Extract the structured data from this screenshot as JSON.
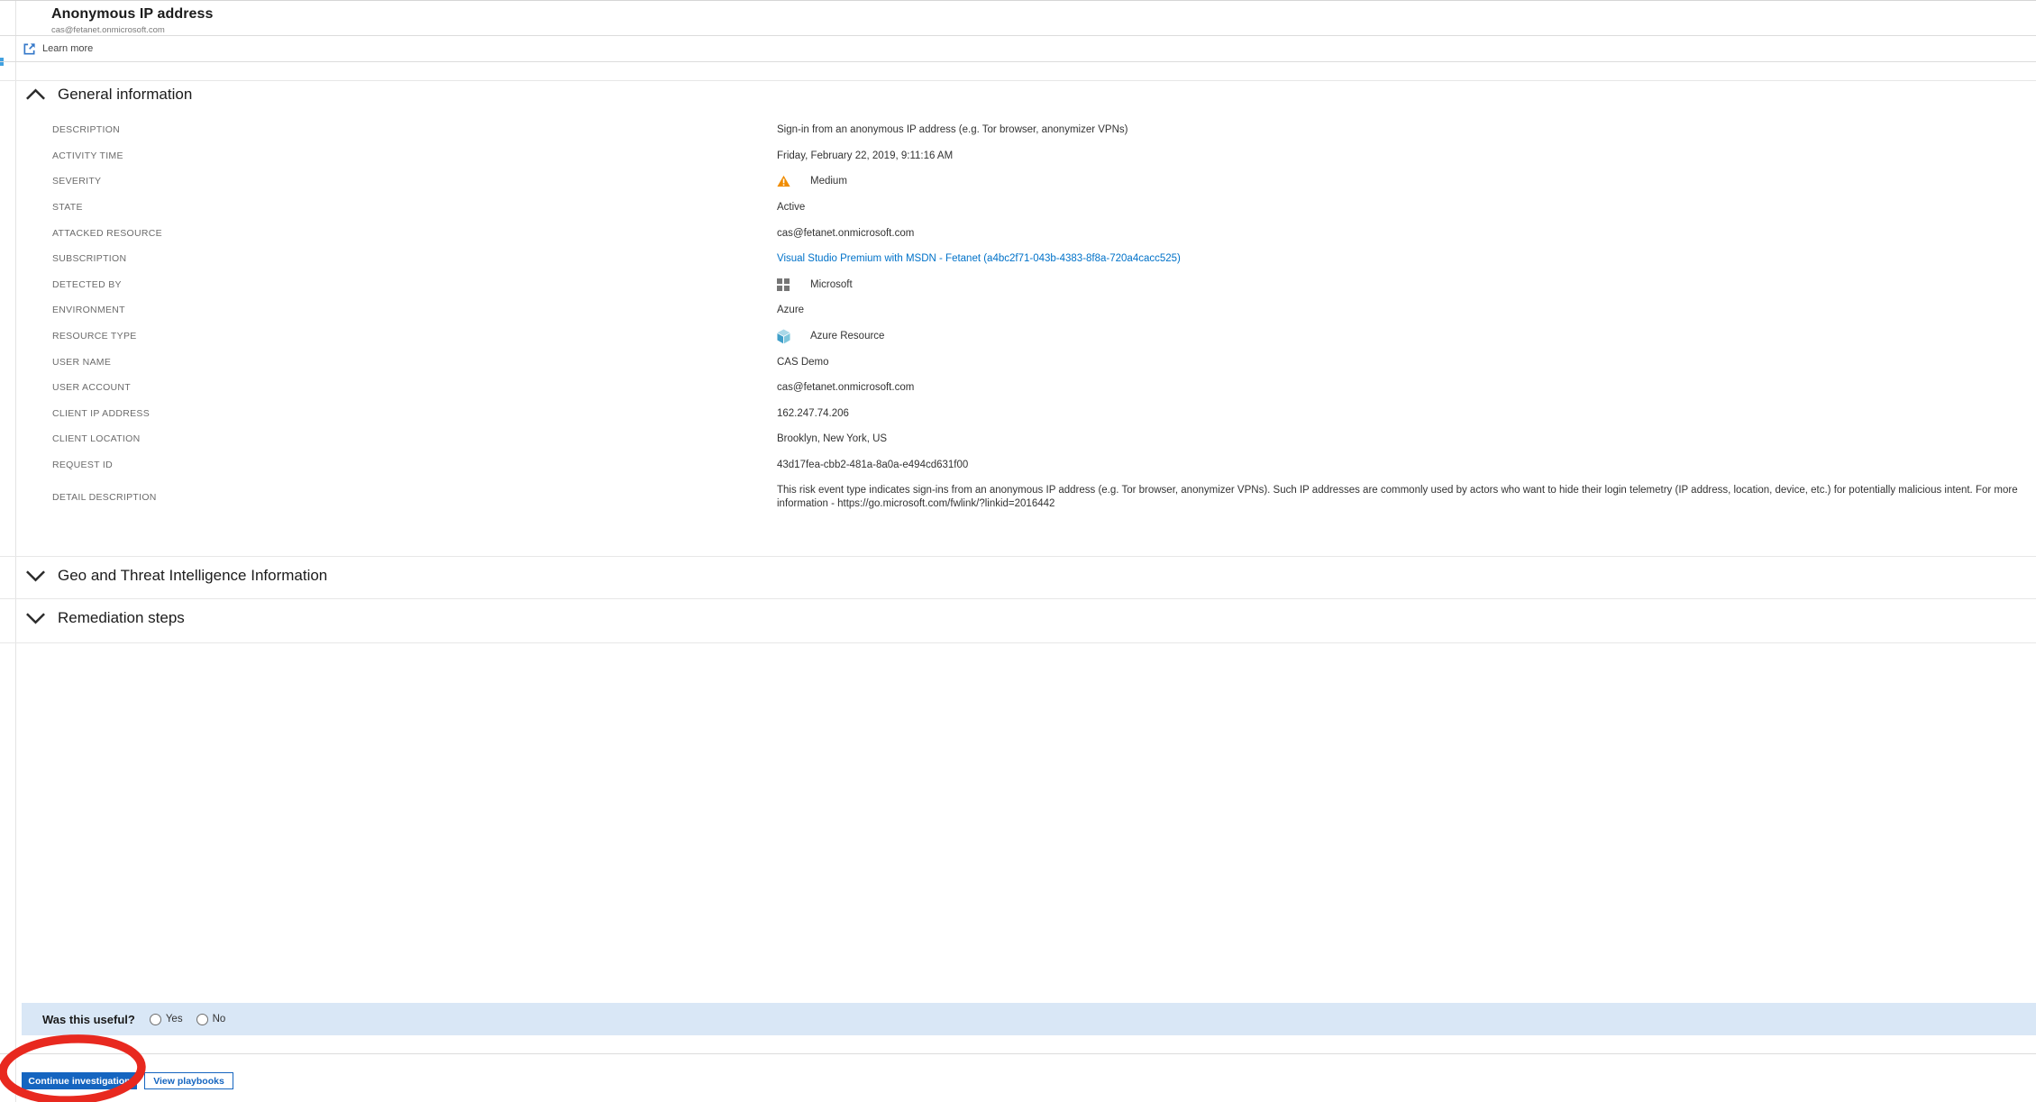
{
  "header": {
    "title": "Anonymous IP address",
    "subtitle": "cas@fetanet.onmicrosoft.com",
    "learn_more_label": "Learn more"
  },
  "sections": {
    "general": {
      "title": "General information",
      "expanded": true
    },
    "geo": {
      "title": "Geo and Threat Intelligence Information",
      "expanded": false
    },
    "remediation": {
      "title": "Remediation steps",
      "expanded": false
    }
  },
  "general": {
    "fields": {
      "description": {
        "label": "DESCRIPTION",
        "value": "Sign-in from an anonymous IP address (e.g. Tor browser, anonymizer VPNs)"
      },
      "activity_time": {
        "label": "ACTIVITY TIME",
        "value": "Friday, February 22, 2019, 9:11:16 AM"
      },
      "severity": {
        "label": "SEVERITY",
        "value": "Medium",
        "icon": "warning-icon"
      },
      "state": {
        "label": "STATE",
        "value": "Active"
      },
      "attacked_resource": {
        "label": "ATTACKED RESOURCE",
        "value": "cas@fetanet.onmicrosoft.com"
      },
      "subscription": {
        "label": "SUBSCRIPTION",
        "value": "Visual Studio Premium with MSDN - Fetanet (a4bc2f71-043b-4383-8f8a-720a4cacc525)",
        "is_link": true
      },
      "detected_by": {
        "label": "DETECTED BY",
        "value": "Microsoft",
        "icon": "microsoft-logo-icon"
      },
      "environment": {
        "label": "ENVIRONMENT",
        "value": "Azure"
      },
      "resource_type": {
        "label": "RESOURCE TYPE",
        "value": "Azure Resource",
        "icon": "azure-resource-cube-icon"
      },
      "user_name": {
        "label": "USER NAME",
        "value": "CAS Demo"
      },
      "user_account": {
        "label": "USER ACCOUNT",
        "value": "cas@fetanet.onmicrosoft.com"
      },
      "client_ip": {
        "label": "CLIENT IP ADDRESS",
        "value": "162.247.74.206"
      },
      "client_location": {
        "label": "CLIENT LOCATION",
        "value": "Brooklyn, New York, US"
      },
      "request_id": {
        "label": "REQUEST ID",
        "value": "43d17fea-cbb2-481a-8a0a-e494cd631f00"
      },
      "detail_description": {
        "label": "DETAIL DESCRIPTION",
        "value": "This risk event type indicates sign-ins from an anonymous IP address (e.g. Tor browser, anonymizer VPNs). Such IP addresses are commonly used by actors who want to hide their login telemetry (IP address, location, device, etc.) for potentially malicious intent. For more information - https://go.microsoft.com/fwlink/?linkid=2016442"
      }
    }
  },
  "feedback": {
    "question": "Was this useful?",
    "yes_label": "Yes",
    "no_label": "No",
    "yes_checked": false,
    "no_checked": false
  },
  "actions": {
    "continue_label": "Continue investigation",
    "playbooks_label": "View playbooks"
  },
  "icons": {
    "learn_more": "external-link-icon",
    "general_chevron": "chevron-up-icon",
    "geo_chevron": "chevron-down-icon",
    "remediation_chevron": "chevron-down-icon",
    "severity": "warning-triangle-icon",
    "detected_by": "microsoft-logo-icon",
    "resource_type": "azure-resource-cube-icon"
  },
  "colors": {
    "link_blue": "#0072c9",
    "button_blue": "#1565c0",
    "warning_orange": "#f08c00",
    "feedback_bar_blue": "#d9e7f6",
    "annotation_red": "#e8291f"
  }
}
